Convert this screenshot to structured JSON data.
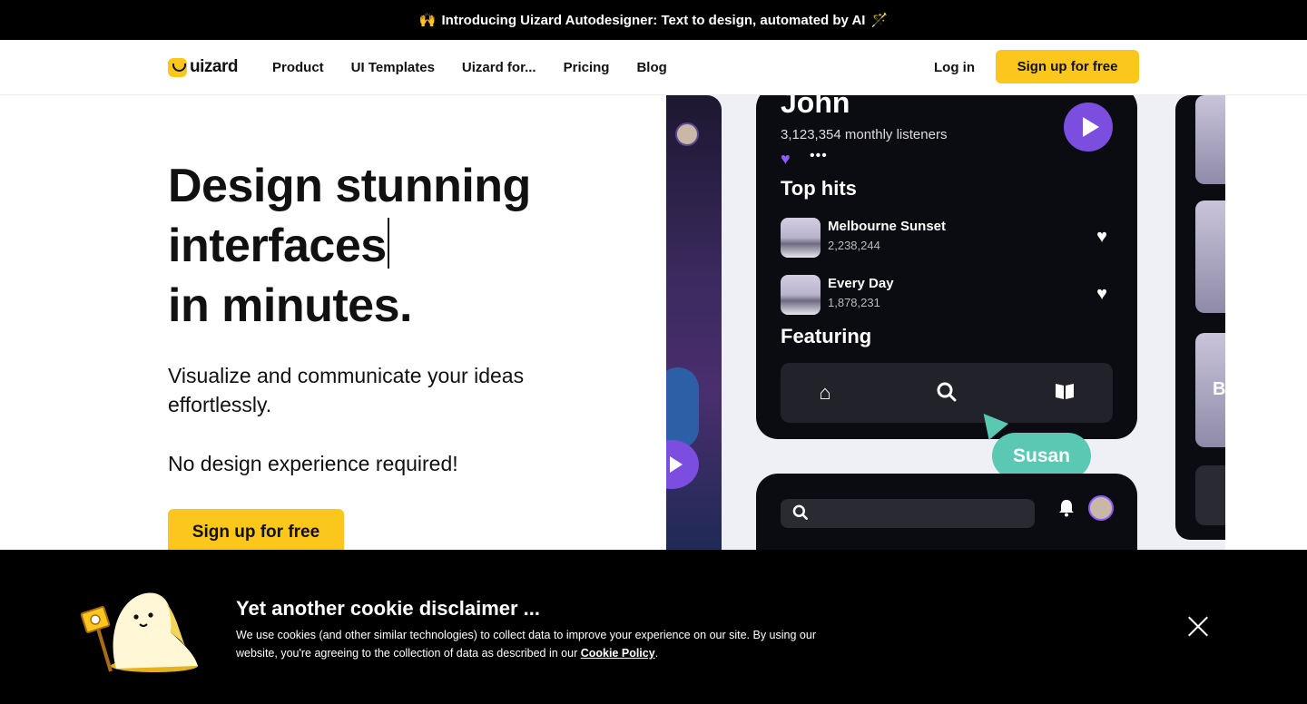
{
  "announcement": {
    "emoji_left": "🙌",
    "text": "Introducing Uizard Autodesigner: Text to design, automated by AI",
    "emoji_right": "🪄"
  },
  "nav": {
    "logo_text": "uizard",
    "links": [
      "Product",
      "UI Templates",
      "Uizard for...",
      "Pricing",
      "Blog"
    ],
    "login": "Log in",
    "signup": "Sign up for free"
  },
  "hero": {
    "title_line1": "Design stunning",
    "title_line2": "interfaces",
    "title_line3": "in minutes.",
    "subtitle": "Visualize and communicate your ideas effortlessly.",
    "subtitle2": "No design experience required!",
    "cta": "Sign up for free"
  },
  "showcase": {
    "artist": "John",
    "listeners": "3,123,354 monthly listeners",
    "top_hits_heading": "Top hits",
    "tracks": [
      {
        "name": "Melbourne Sunset",
        "count": "2,238,244"
      },
      {
        "name": "Every Day",
        "count": "1,878,231"
      }
    ],
    "featuring_heading": "Featuring",
    "cursor_label": "Susan",
    "right_letter": "B",
    "accent_purple": "#7b4ee0",
    "accent_teal": "#5ac8b3"
  },
  "cookie": {
    "title": "Yet another cookie disclaimer ...",
    "text_before": "We use cookies (and other similar technologies) to collect data to improve your experience on our site. By using our website, you're agreeing to the collection of data as described in our ",
    "link": "Cookie Policy",
    "text_after": "."
  },
  "colors": {
    "brand_yellow": "#fbc71c",
    "dark": "#000000"
  }
}
